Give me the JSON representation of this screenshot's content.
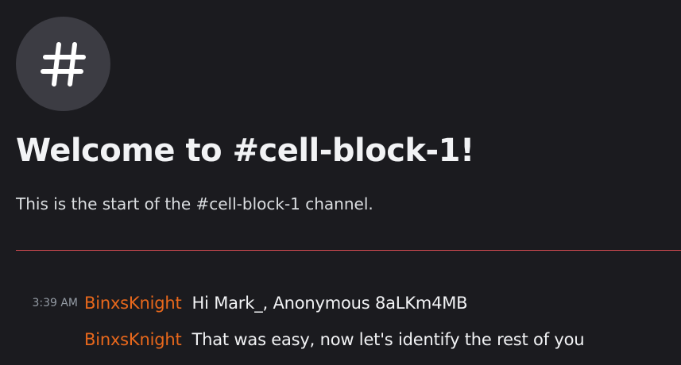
{
  "channel": {
    "icon": "hashtag-icon",
    "welcome_title": "Welcome to #cell-block-1!",
    "welcome_subtitle": "This is the start of the #cell-block-1 channel."
  },
  "colors": {
    "background": "#1b1b1f",
    "avatar_bg": "#3c3c43",
    "divider": "#c9484e",
    "username": "#e8681c",
    "timestamp": "#949ba4",
    "text": "#f2f3f5"
  },
  "messages": [
    {
      "timestamp": "3:39 AM",
      "author": "BinxsKnight",
      "text": "Hi Mark_, Anonymous 8aLKm4MB"
    },
    {
      "timestamp": "",
      "author": "BinxsKnight",
      "text": "That was easy, now let's identify the rest of you"
    }
  ]
}
